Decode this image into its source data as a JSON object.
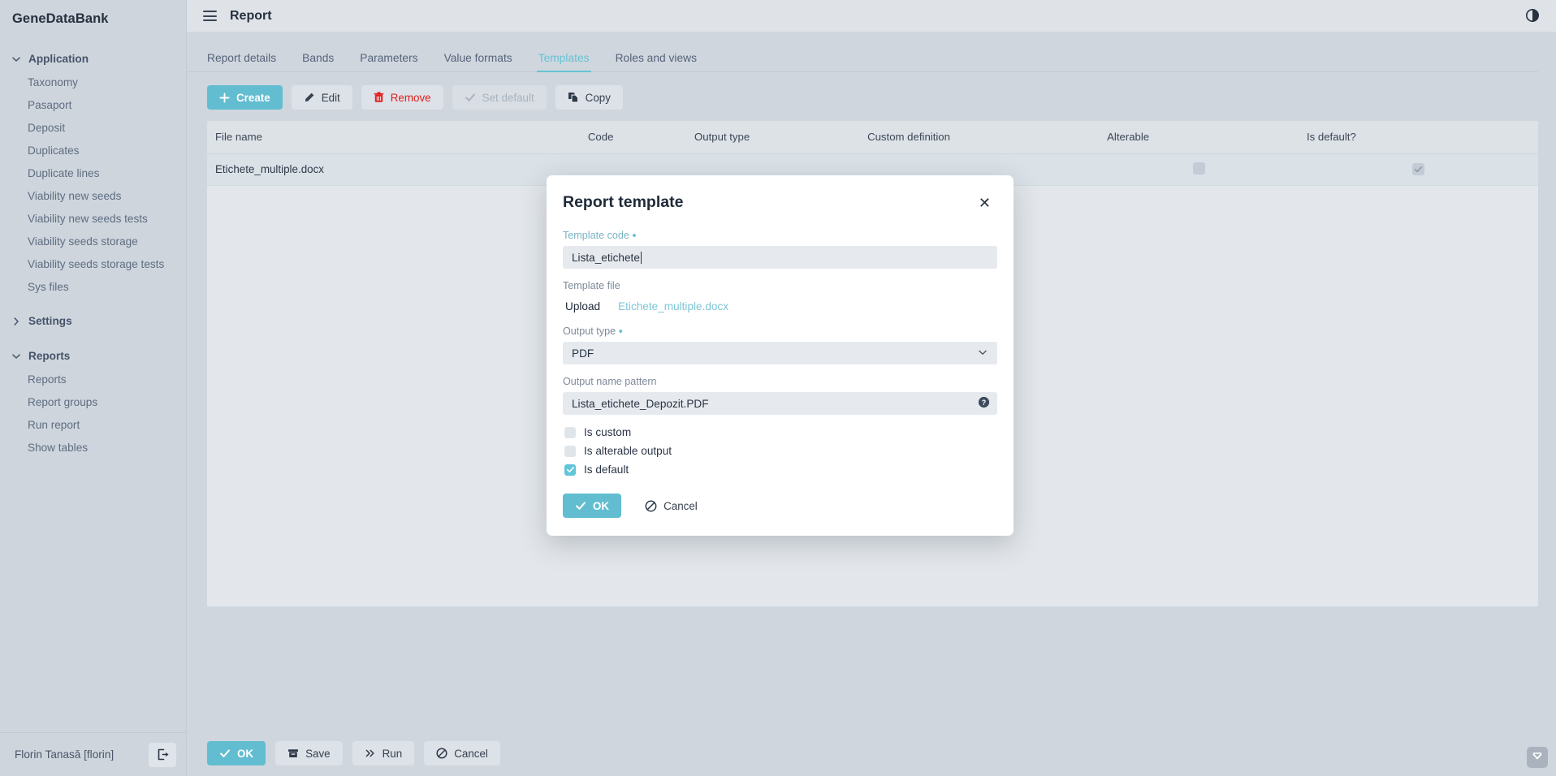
{
  "sidebar": {
    "brand": "GeneDataBank",
    "groups": [
      {
        "label": "Application",
        "expanded": true,
        "items": [
          "Taxonomy",
          "Pasaport",
          "Deposit",
          "Duplicates",
          "Duplicate lines",
          "Viability new seeds",
          "Viability new seeds tests",
          "Viability seeds storage",
          "Viability seeds storage tests",
          "Sys files"
        ]
      },
      {
        "label": "Settings",
        "expanded": false,
        "items": []
      },
      {
        "label": "Reports",
        "expanded": true,
        "items": [
          "Reports",
          "Report groups",
          "Run report",
          "Show tables"
        ]
      }
    ],
    "user": "Florin Tanasă [florin]",
    "logout_icon": "logout-icon"
  },
  "topbar": {
    "menu_icon": "hamburger-icon",
    "title": "Report",
    "theme_icon": "theme-contrast-icon"
  },
  "tabs": [
    {
      "label": "Report details",
      "active": false
    },
    {
      "label": "Bands",
      "active": false
    },
    {
      "label": "Parameters",
      "active": false
    },
    {
      "label": "Value formats",
      "active": false
    },
    {
      "label": "Templates",
      "active": true
    },
    {
      "label": "Roles and views",
      "active": false
    }
  ],
  "toolbar": {
    "create": "Create",
    "edit": "Edit",
    "remove": "Remove",
    "set_default": "Set default",
    "copy": "Copy"
  },
  "table": {
    "columns": [
      "File name",
      "Code",
      "Output type",
      "Custom definition",
      "Alterable",
      "Is default?"
    ],
    "rows": [
      {
        "file_name": "Etichete_multiple.docx",
        "code": "",
        "output_type": "",
        "custom_definition": "",
        "alterable": false,
        "is_default": true
      }
    ]
  },
  "bottombar": {
    "ok": "OK",
    "save": "Save",
    "run": "Run",
    "cancel": "Cancel"
  },
  "modal": {
    "title": "Report template",
    "close_icon": "close-icon",
    "template_code": {
      "label": "Template code",
      "required": true,
      "value": "Lista_etichete"
    },
    "template_file": {
      "label": "Template file",
      "upload": "Upload",
      "file": "Etichete_multiple.docx"
    },
    "output_type": {
      "label": "Output type",
      "required": true,
      "value": "PDF"
    },
    "output_name_pattern": {
      "label": "Output name pattern",
      "value": "Lista_etichete_Depozit.PDF",
      "help_icon": "help-circle-icon"
    },
    "checks": [
      {
        "label": "Is custom",
        "checked": false
      },
      {
        "label": "Is alterable output",
        "checked": false
      },
      {
        "label": "Is default",
        "checked": true
      }
    ],
    "ok": "OK",
    "cancel": "Cancel"
  },
  "colors": {
    "accent": "#62bdd0",
    "danger": "#e02020",
    "link": "#7ec6d6",
    "sidebar_bg": "#ced5dd",
    "page_bg": "#cfd6de"
  },
  "corner_widget": "scroll-down-widget"
}
